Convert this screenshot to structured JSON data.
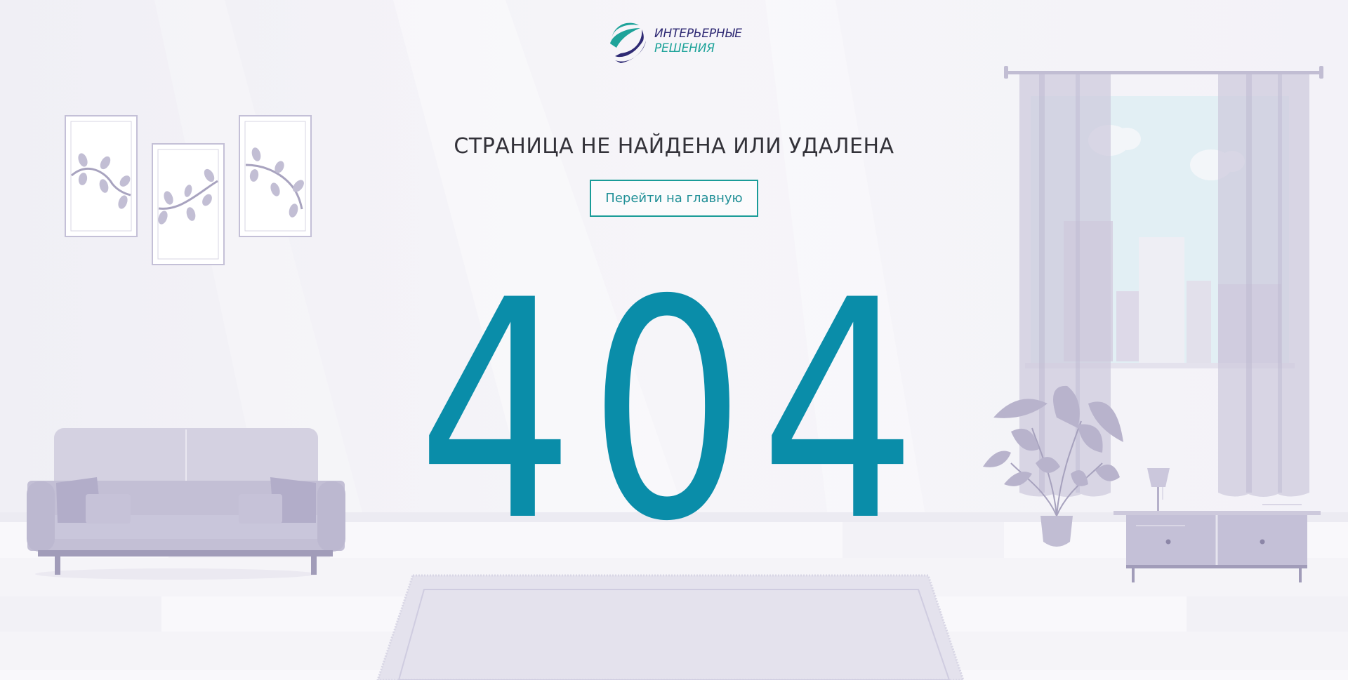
{
  "brand": {
    "line1": "ИНТЕРЬЕРНЫЕ",
    "line2": "РЕШЕНИЯ",
    "primary_color": "#2f2a74",
    "accent_color": "#1ea39a"
  },
  "error": {
    "title": "СТРАНИЦА НЕ НАЙДЕНА ИЛИ УДАЛЕНА",
    "code": "404",
    "code_color": "#0a8da9"
  },
  "actions": {
    "home_label": "Перейти на главную"
  },
  "illustration": {
    "palette": {
      "background": "#f3f2f7",
      "furniture": "#c4c0d5",
      "furniture_dark": "#a19cb9",
      "window_sky": "#dcebf1"
    }
  }
}
